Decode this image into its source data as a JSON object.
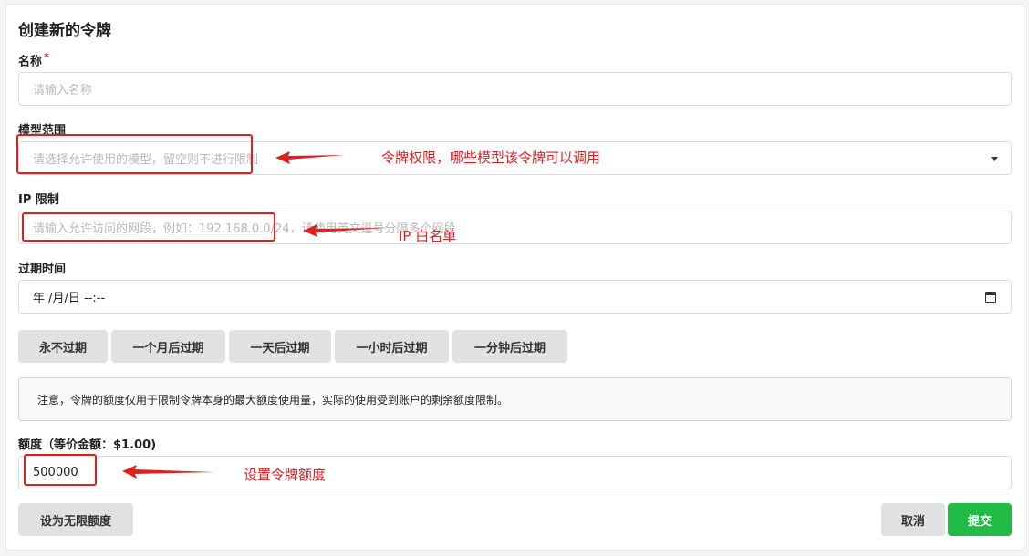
{
  "form": {
    "title": "创建新的令牌",
    "name": {
      "label": "名称",
      "required_mark": "*",
      "placeholder": "请输入名称"
    },
    "models": {
      "label": "模型范围",
      "placeholder": "请选择允许使用的模型，留空则不进行限制"
    },
    "ip": {
      "label": "IP 限制",
      "placeholder": "请输入允许访问的网段，例如：192.168.0.0/24，请使用英文逗号分隔多个网段"
    },
    "expire": {
      "label": "过期时间",
      "value": "年 /月/日 --:--"
    },
    "expire_buttons": [
      "永不过期",
      "一个月后过期",
      "一天后过期",
      "一小时后过期",
      "一分钟后过期"
    ],
    "notice": "注意，令牌的额度仅用于限制令牌本身的最大额度使用量，实际的使用受到账户的剩余额度限制。",
    "quota": {
      "label": "额度（等价金额：$1.00)",
      "value": "500000"
    },
    "unlimited_button": "设为无限额度",
    "cancel_button": "取消",
    "submit_button": "提交"
  },
  "annotations": {
    "models_note": "令牌权限，哪些模型该令牌可以调用",
    "ip_note": "IP 白名单",
    "quota_note": "设置令牌额度",
    "color": "#e02020"
  }
}
